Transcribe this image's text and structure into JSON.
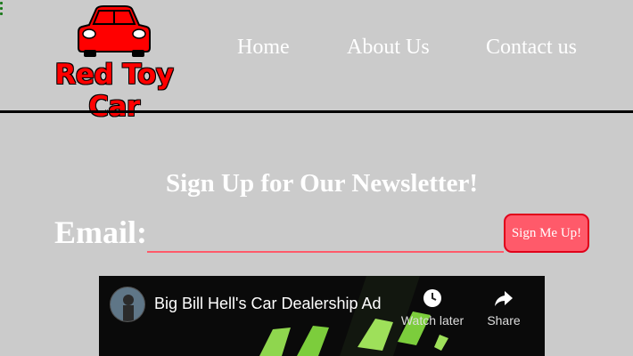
{
  "header": {
    "logo_text": "Red Toy Car",
    "nav": [
      {
        "label": "Home"
      },
      {
        "label": "About Us"
      },
      {
        "label": "Contact us"
      }
    ]
  },
  "newsletter": {
    "headline": "Sign Up for Our Newsletter!",
    "email_label": "Email:",
    "email_value": "",
    "email_placeholder": "",
    "button_label": "Sign Me Up!"
  },
  "video": {
    "title": "Big Bill Hell's Car Dealership Ad",
    "watch_later_label": "Watch later",
    "share_label": "Share"
  },
  "colors": {
    "background": "#cbcbcb",
    "brand_red": "#ff0000",
    "button": "#ff5a6a",
    "input_underline": "#ff5a6a",
    "nav_text": "#ffffff"
  },
  "icons": [
    "menu-icon",
    "car-icon",
    "channel-avatar",
    "clock-icon",
    "share-icon"
  ]
}
